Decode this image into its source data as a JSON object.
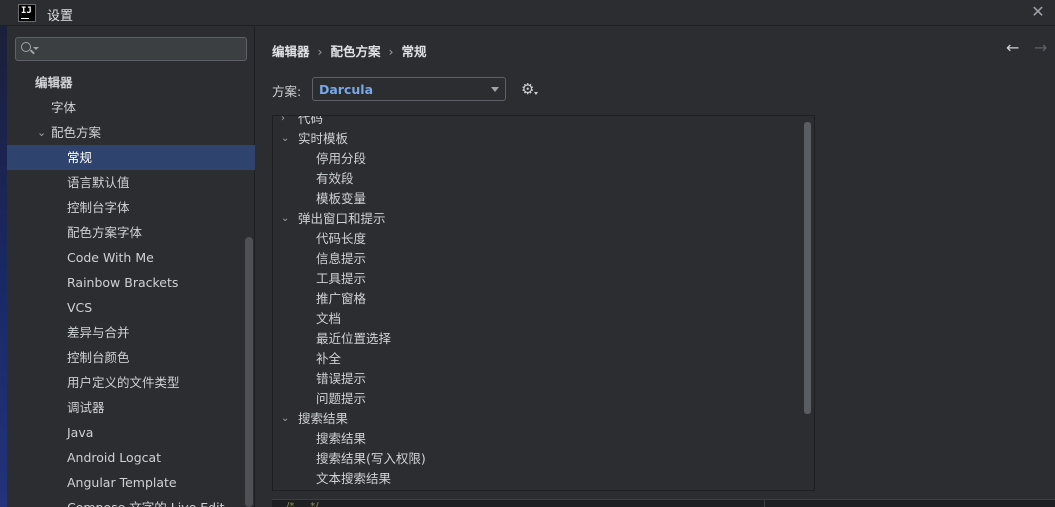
{
  "window": {
    "title": "设置",
    "app_icon": "IJ",
    "close_glyph": "✕"
  },
  "search": {
    "placeholder": ""
  },
  "sidebar": {
    "items": [
      {
        "label": "编辑器",
        "level": 0,
        "bold": true
      },
      {
        "label": "字体",
        "level": 1
      },
      {
        "label": "配色方案",
        "level": 1,
        "expanded": true
      },
      {
        "label": "常规",
        "level": 2,
        "selected": true
      },
      {
        "label": "语言默认值",
        "level": 2
      },
      {
        "label": "控制台字体",
        "level": 2
      },
      {
        "label": "配色方案字体",
        "level": 2
      },
      {
        "label": "Code With Me",
        "level": 2
      },
      {
        "label": "Rainbow Brackets",
        "level": 2
      },
      {
        "label": "VCS",
        "level": 2
      },
      {
        "label": "差异与合并",
        "level": 2
      },
      {
        "label": "控制台颜色",
        "level": 2
      },
      {
        "label": "用户定义的文件类型",
        "level": 2
      },
      {
        "label": "调试器",
        "level": 2
      },
      {
        "label": "Java",
        "level": 2
      },
      {
        "label": "Android Logcat",
        "level": 2
      },
      {
        "label": "Angular Template",
        "level": 2
      },
      {
        "label": "Compose 文字的 Live Edit",
        "level": 2
      }
    ]
  },
  "breadcrumb": {
    "items": [
      "编辑器",
      "配色方案",
      "常规"
    ],
    "separator": "›"
  },
  "nav": {
    "back": "←",
    "forward": "→"
  },
  "scheme": {
    "label": "方案:",
    "value": "Darcula",
    "value_color": "#7aa7e6"
  },
  "tree": {
    "rows": [
      {
        "label": "代码",
        "level": 0,
        "chevron": "›"
      },
      {
        "label": "实时模板",
        "level": 0,
        "chevron": "⌄"
      },
      {
        "label": "停用分段",
        "level": 1
      },
      {
        "label": "有效段",
        "level": 1
      },
      {
        "label": "模板变量",
        "level": 1
      },
      {
        "label": "弹出窗口和提示",
        "level": 0,
        "chevron": "⌄"
      },
      {
        "label": "代码长度",
        "level": 1
      },
      {
        "label": "信息提示",
        "level": 1
      },
      {
        "label": "工具提示",
        "level": 1
      },
      {
        "label": "推广窗格",
        "level": 1
      },
      {
        "label": "文档",
        "level": 1
      },
      {
        "label": "最近位置选择",
        "level": 1
      },
      {
        "label": "补全",
        "level": 1
      },
      {
        "label": "错误提示",
        "level": 1
      },
      {
        "label": "问题提示",
        "level": 1
      },
      {
        "label": "搜索结果",
        "level": 0,
        "chevron": "⌄"
      },
      {
        "label": "搜索结果",
        "level": 1
      },
      {
        "label": "搜索结果(写入权限)",
        "level": 1
      },
      {
        "label": "文本搜索结果",
        "level": 1
      }
    ]
  },
  "preview": {
    "text": "/* ... */"
  }
}
